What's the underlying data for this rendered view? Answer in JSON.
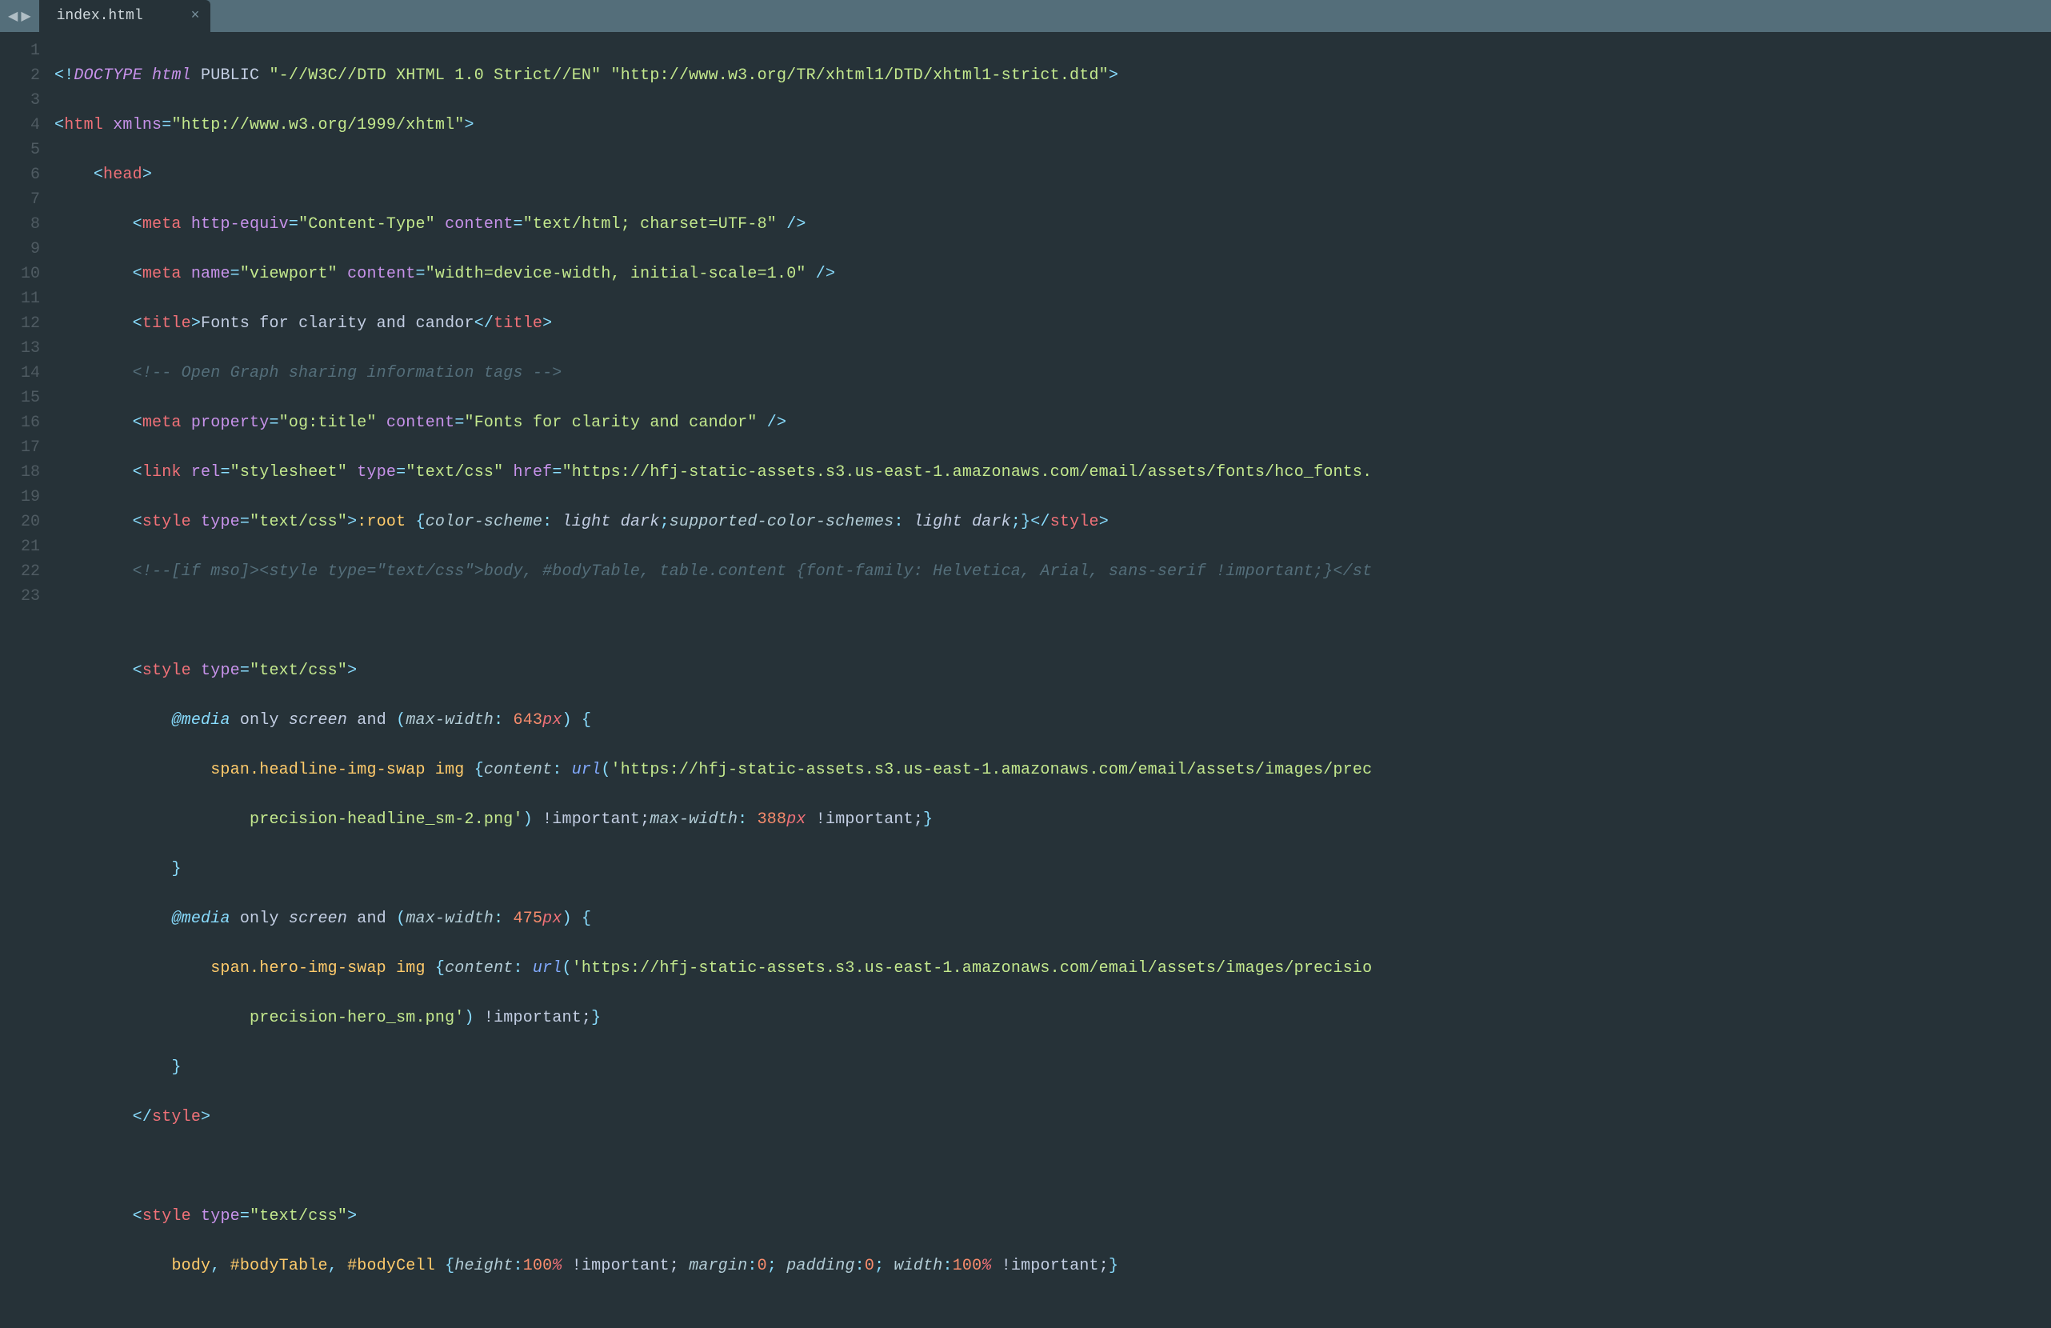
{
  "tab": {
    "title": "index.html",
    "close": "×"
  },
  "nav": {
    "left": "◀",
    "right": "▶"
  },
  "gutter": [
    "1",
    "2",
    "3",
    "4",
    "5",
    "6",
    "7",
    "8",
    "9",
    "10",
    "11",
    "12",
    "13",
    "14",
    "15",
    "",
    "16",
    "17",
    "18",
    "",
    "19",
    "20",
    "21",
    "22",
    "23"
  ],
  "code": {
    "l1": {
      "a": "<!",
      "b": "DOCTYPE ",
      "c": "html",
      "d": " PUBLIC ",
      "e": "\"-//W3C//DTD XHTML 1.0 Strict//EN\"",
      "f": " ",
      "g": "\"http://www.w3.org/TR/xhtml1/DTD/xhtml1-strict.dtd\"",
      "h": ">"
    },
    "l2": {
      "a": "<",
      "b": "html ",
      "c": "xmlns",
      "d": "=",
      "e": "\"http://www.w3.org/1999/xhtml\"",
      "f": ">"
    },
    "l3": {
      "a": "<",
      "b": "head",
      "c": ">"
    },
    "l4": {
      "a": "<",
      "b": "meta ",
      "c": "http-equiv",
      "d": "=",
      "e": "\"Content-Type\"",
      "f": " ",
      "g": "content",
      "h": "=",
      "i": "\"text/html; charset=UTF-8\"",
      "j": " />"
    },
    "l5": {
      "a": "<",
      "b": "meta ",
      "c": "name",
      "d": "=",
      "e": "\"viewport\"",
      "f": " ",
      "g": "content",
      "h": "=",
      "i": "\"width=device-width, initial-scale=1.0\"",
      "j": " />"
    },
    "l6": {
      "a": "<",
      "b": "title",
      "c": ">",
      "d": "Fonts for clarity and candor",
      "e": "</",
      "f": "title",
      "g": ">"
    },
    "l7": {
      "a": "<!-- Open Graph sharing information tags -->"
    },
    "l8": {
      "a": "<",
      "b": "meta ",
      "c": "property",
      "d": "=",
      "e": "\"og:title\"",
      "f": " ",
      "g": "content",
      "h": "=",
      "i": "\"Fonts for clarity and candor\"",
      "j": " />"
    },
    "l9": {
      "a": "<",
      "b": "link ",
      "c": "rel",
      "d": "=",
      "e": "\"stylesheet\"",
      "f": " ",
      "g": "type",
      "h": "=",
      "i": "\"text/css\"",
      "j": " ",
      "k": "href",
      "l": "=",
      "m": "\"https://hfj-static-assets.s3.us-east-1.amazonaws.com/email/assets/fonts/hco_fonts."
    },
    "l10": {
      "a": "<",
      "b": "style ",
      "c": "type",
      "d": "=",
      "e": "\"text/css\"",
      "f": ">",
      "g": ":root ",
      "h": "{",
      "i": "color-scheme",
      "j": ": ",
      "k": "light dark",
      "l": ";",
      "m": "supported-color-schemes",
      "n": ": ",
      "o": "light dark",
      "p": ";",
      "q": "}",
      "r": "</",
      "s": "style",
      "t": ">"
    },
    "l11": {
      "a": "<!--[if mso]><style type=\"text/css\">body, #bodyTable, table.content {font-family: Helvetica, Arial, sans-serif !important;}</st"
    },
    "l12": "",
    "l13": {
      "a": "<",
      "b": "style ",
      "c": "type",
      "d": "=",
      "e": "\"text/css\"",
      "f": ">"
    },
    "l14": {
      "a": "@media",
      "b": " only ",
      "c": "screen",
      "d": " and ",
      "e": "(",
      "f": "max-width",
      "g": ": ",
      "h": "643",
      "i": "px",
      "j": ") ",
      "k": "{"
    },
    "l15": {
      "a": "span",
      "b": ".headline-img-swap ",
      "c": "img ",
      "d": "{",
      "e": "content",
      "f": ": ",
      "g": "url",
      "h": "(",
      "i": "'https://hfj-static-assets.s3.us-east-1.amazonaws.com/email/assets/images/prec"
    },
    "l15b": {
      "a": "precision-headline_sm-2.png'",
      "b": ")",
      "c": " !important;",
      "d": "max-width",
      "e": ": ",
      "f": "388",
      "g": "px",
      "h": " !important;",
      "i": "}"
    },
    "l16": {
      "a": "}"
    },
    "l17": {
      "a": "@media",
      "b": " only ",
      "c": "screen",
      "d": " and ",
      "e": "(",
      "f": "max-width",
      "g": ": ",
      "h": "475",
      "i": "px",
      "j": ") ",
      "k": "{"
    },
    "l18": {
      "a": "span",
      "b": ".hero-img-swap ",
      "c": "img ",
      "d": "{",
      "e": "content",
      "f": ": ",
      "g": "url",
      "h": "(",
      "i": "'https://hfj-static-assets.s3.us-east-1.amazonaws.com/email/assets/images/precisio"
    },
    "l18b": {
      "a": "precision-hero_sm.png'",
      "b": ")",
      "c": " !important;",
      "d": "}"
    },
    "l19": {
      "a": "}"
    },
    "l20": {
      "a": "</",
      "b": "style",
      "c": ">"
    },
    "l21": "",
    "l22": {
      "a": "<",
      "b": "style ",
      "c": "type",
      "d": "=",
      "e": "\"text/css\"",
      "f": ">"
    },
    "l23": {
      "a": "body",
      "b": ", ",
      "c": "#bodyTable",
      "d": ", ",
      "e": "#bodyCell ",
      "f": "{",
      "g": "height",
      "h": ":",
      "i": "100",
      "j": "%",
      "k": " !important; ",
      "l": "margin",
      "m": ":",
      "n": "0",
      "o": "; ",
      "p": "padding",
      "q": ":",
      "r": "0",
      "s": "; ",
      "t": "width",
      "u": ":",
      "v": "100",
      "w": "%",
      "x": " !important;",
      "y": "}"
    }
  }
}
